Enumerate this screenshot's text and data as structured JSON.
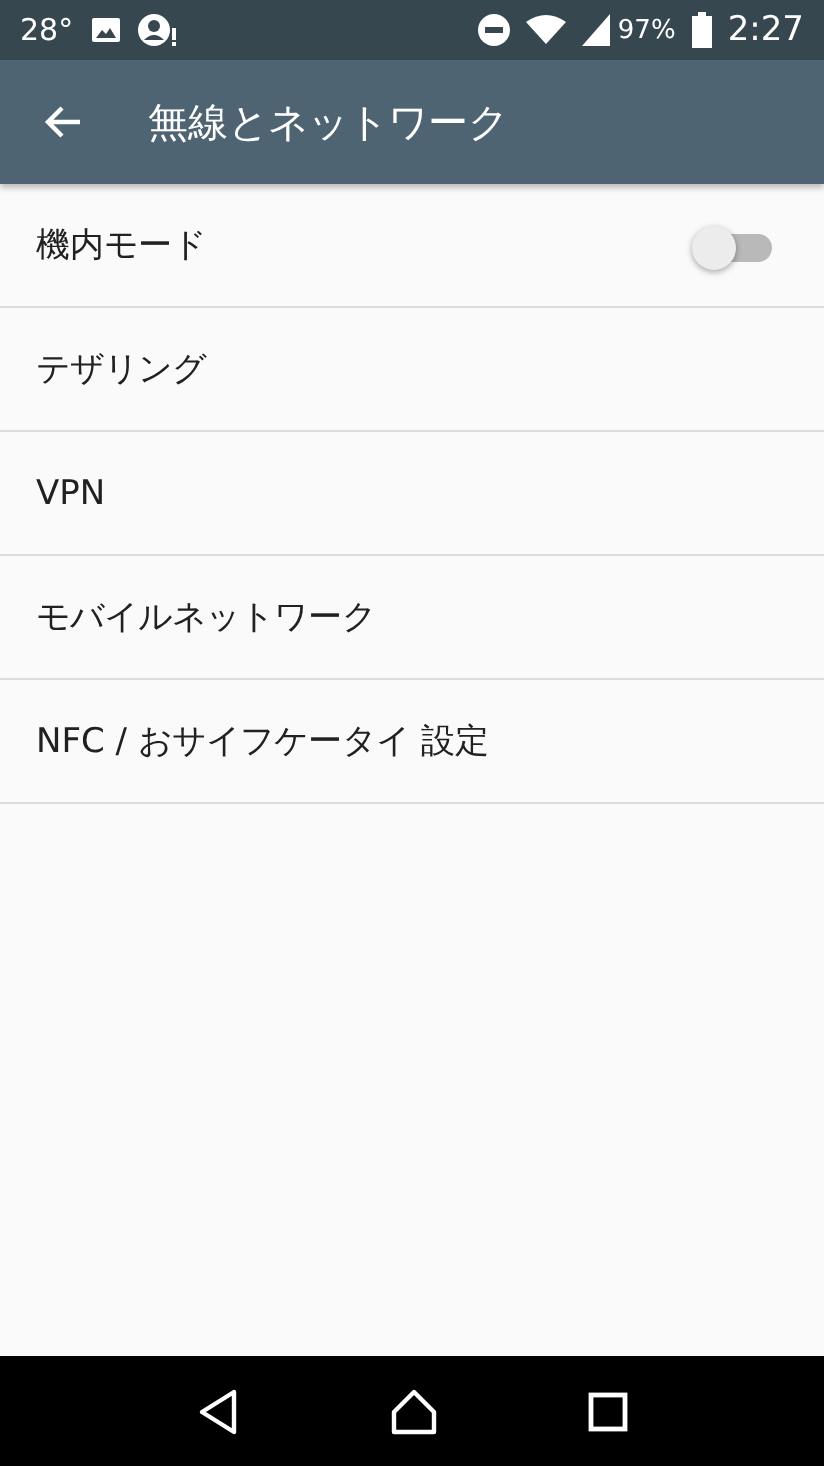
{
  "status_bar": {
    "temperature": "28°",
    "battery": "97%",
    "time": "2:27"
  },
  "app_bar": {
    "title": "無線とネットワーク"
  },
  "items": [
    {
      "kind": "switch",
      "label": "機内モード",
      "on": false
    },
    {
      "kind": "link",
      "label": "テザリング"
    },
    {
      "kind": "link",
      "label": "VPN"
    },
    {
      "kind": "link",
      "label": "モバイルネットワーク"
    },
    {
      "kind": "link",
      "label": "NFC / おサイフケータイ 設定"
    }
  ]
}
